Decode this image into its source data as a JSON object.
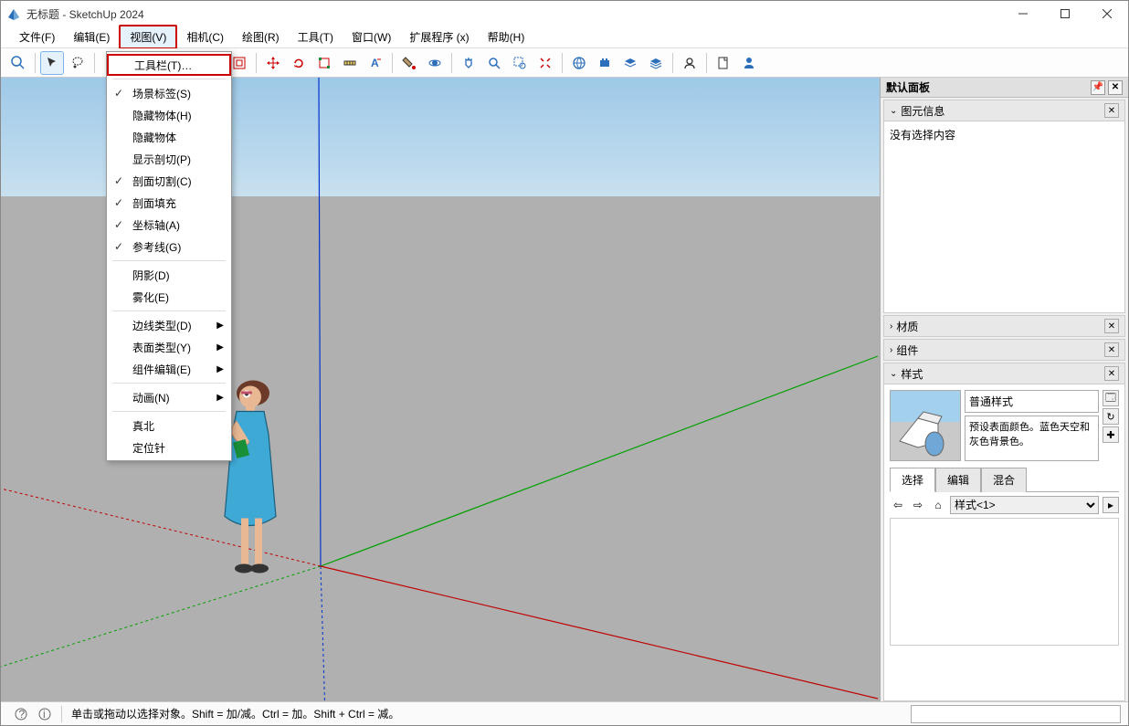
{
  "title": "无标题 - SketchUp 2024",
  "menus": {
    "file": "文件(F)",
    "edit": "编辑(E)",
    "view": "视图(V)",
    "camera": "相机(C)",
    "draw": "绘图(R)",
    "tools": "工具(T)",
    "window": "窗口(W)",
    "extensions": "扩展程序 (x)",
    "help": "帮助(H)"
  },
  "view_menu": {
    "toolbars": "工具栏(T)…",
    "scene_tabs": "场景标签(S)",
    "hidden_objects": "隐藏物体(H)",
    "hidden_objects2": "隐藏物体",
    "show_section": "显示剖切(P)",
    "section_cuts": "剖面切割(C)",
    "section_fill": "剖面填充",
    "axes": "坐标轴(A)",
    "guides": "参考线(G)",
    "shadows": "阴影(D)",
    "fog": "雾化(E)",
    "edge_style": "边线类型(D)",
    "face_style": "表面类型(Y)",
    "component_edit": "组件编辑(E)",
    "animation": "动画(N)",
    "true_north": "真北",
    "anchor": "定位针"
  },
  "panels": {
    "default_panel": "默认面板",
    "entity_info": "图元信息",
    "no_selection": "没有选择内容",
    "materials": "材质",
    "components": "组件",
    "styles": "样式",
    "style_name": "普通样式",
    "style_desc": "预设表面颜色。蓝色天空和灰色背景色。",
    "tab_select": "选择",
    "tab_edit": "编辑",
    "tab_mix": "混合",
    "style_collection": "样式<1>"
  },
  "status": {
    "message": "单击或拖动以选择对象。Shift = 加/减。Ctrl = 加。Shift + Ctrl = 减。"
  }
}
